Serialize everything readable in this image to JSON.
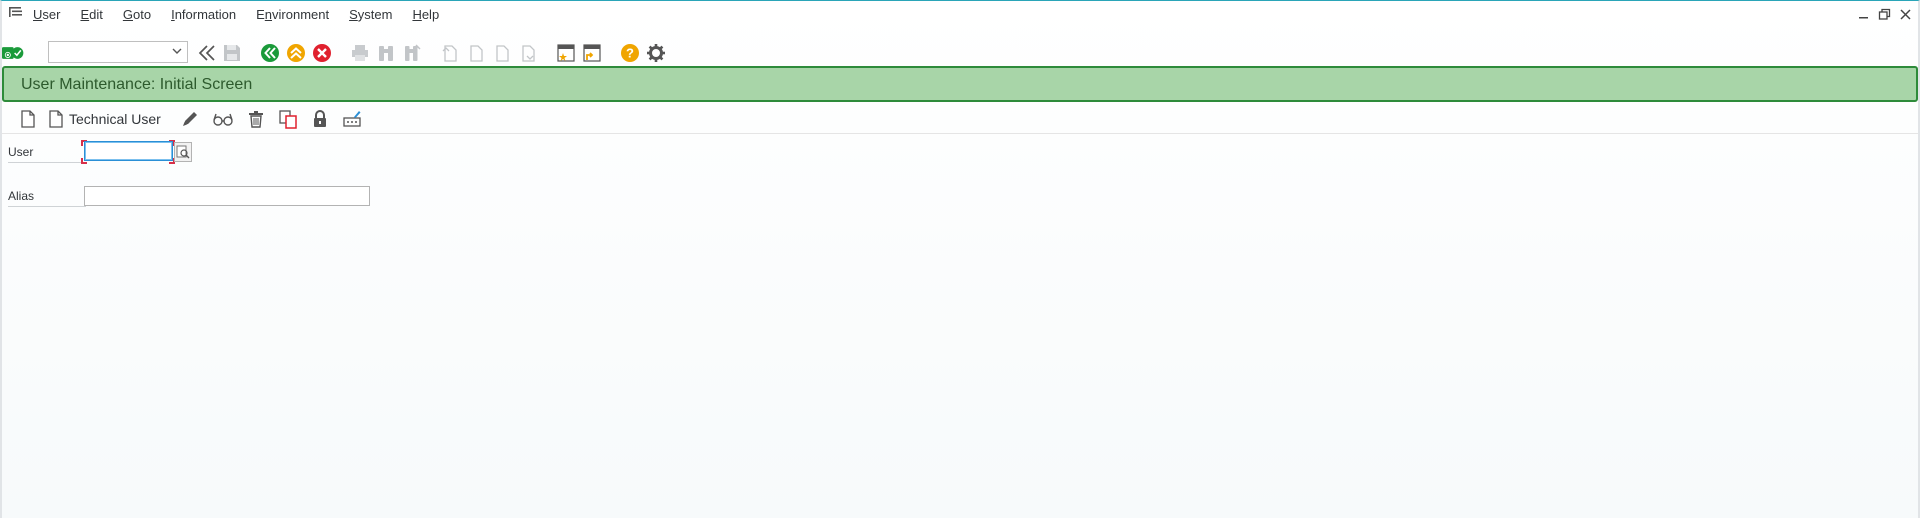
{
  "menu": {
    "items": [
      {
        "label": "User",
        "mnemonic": "U",
        "rest": "ser"
      },
      {
        "label": "Edit",
        "mnemonic": "E",
        "rest": "dit"
      },
      {
        "label": "Goto",
        "mnemonic": "G",
        "rest": "oto"
      },
      {
        "label": "Information",
        "mnemonic": "I",
        "rest": "nformation"
      },
      {
        "label": "Environment",
        "mnemonic": "n",
        "pre": "E",
        "rest": "vironment"
      },
      {
        "label": "System",
        "mnemonic": "S",
        "rest": "ystem"
      },
      {
        "label": "Help",
        "mnemonic": "H",
        "rest": "elp"
      }
    ]
  },
  "command_field": {
    "value": ""
  },
  "title": "User Maintenance: Initial Screen",
  "app_toolbar": {
    "technical_user_label": "Technical User"
  },
  "form": {
    "user_label": "User",
    "user_value": "",
    "alias_label": "Alias",
    "alias_value": ""
  },
  "colors": {
    "title_bg": "#a8d5a8",
    "title_border": "#2e8b3a",
    "enter_green": "#1a9a3a",
    "back_green": "#1a9a3a",
    "exit_orange": "#f0a500",
    "cancel_red": "#e0202e",
    "help_orange": "#f0a500"
  }
}
